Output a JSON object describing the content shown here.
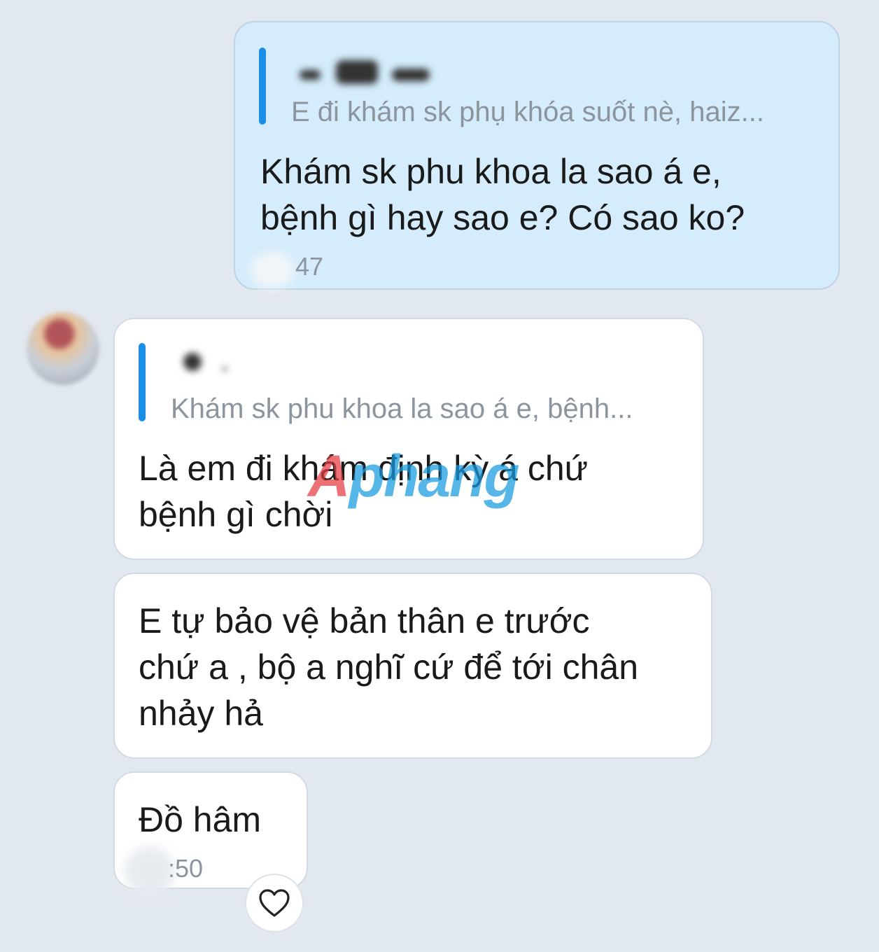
{
  "messages": [
    {
      "direction": "sent",
      "quote_text": "E đi khám sk phụ khóa suốt nè, haiz...",
      "text": "Khám sk phu khoa la sao á e,\nbệnh gì hay sao e? Có sao ko?",
      "time": "47"
    },
    {
      "direction": "received",
      "quote_text": "Khám sk phu khoa la sao á e, bệnh...",
      "text": "Là em đi khám định kỳ á chứ\nbệnh gì chời"
    },
    {
      "direction": "received",
      "text": "E tự bảo vệ bản thân e trước\nchứ a , bộ a nghĩ cứ để tới chân\nnhảy hả"
    },
    {
      "direction": "received",
      "text": "Đồ hâm",
      "time": ":50"
    }
  ],
  "watermark": {
    "first": "A",
    "rest": "phang"
  },
  "colors": {
    "background": "#e2e8ef",
    "sent_bubble": "#d4ecfb",
    "received_bubble": "#ffffff",
    "quote_bar": "#1b8fe8"
  },
  "icons": {
    "reaction": "heart-icon"
  }
}
